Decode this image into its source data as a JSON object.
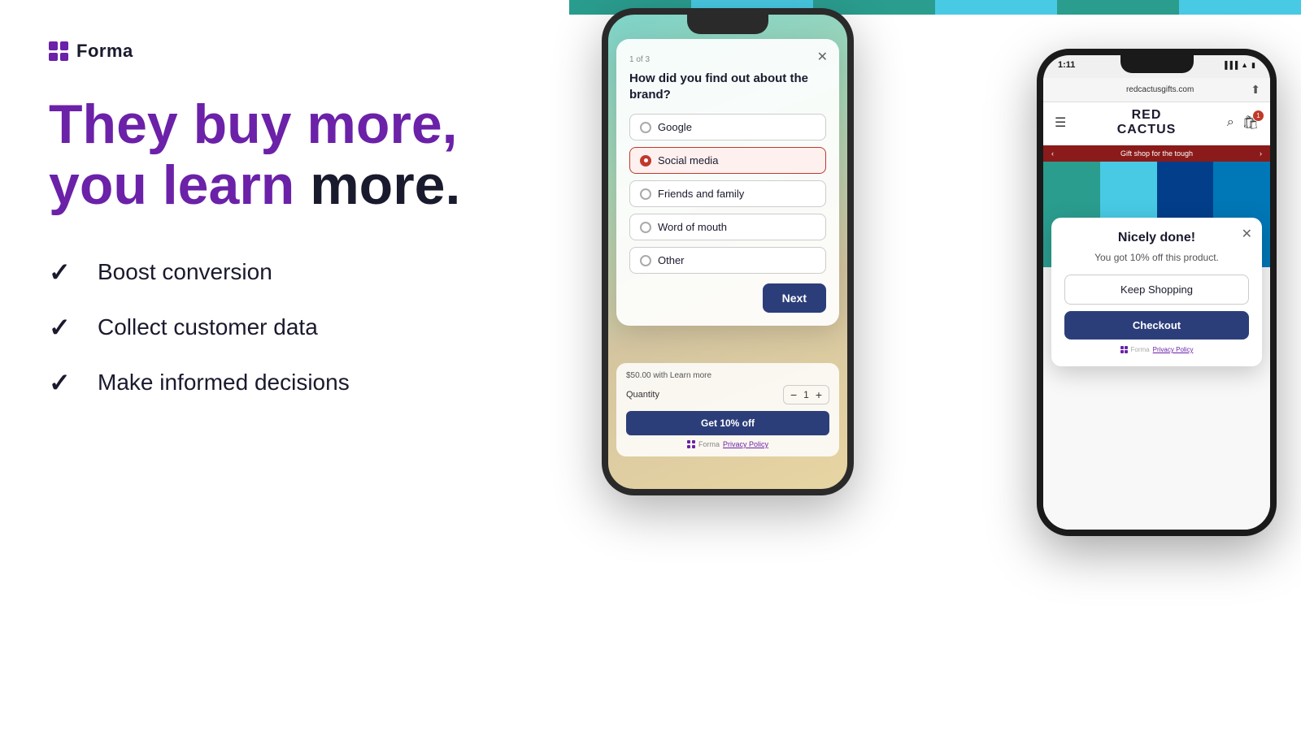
{
  "brand": {
    "name": "Forma",
    "logo_label": "Forma"
  },
  "hero": {
    "line1_purple": "They buy more,",
    "line2_purple": "you learn",
    "line2_dark": "more."
  },
  "features": [
    {
      "id": "boost",
      "label": "Boost conversion"
    },
    {
      "id": "collect",
      "label": "Collect customer data"
    },
    {
      "id": "decisions",
      "label": "Make informed decisions"
    }
  ],
  "survey_phone": {
    "progress": "1 of 3",
    "question": "How did you find out about the brand?",
    "options": [
      {
        "id": "google",
        "label": "Google",
        "selected": false
      },
      {
        "id": "social",
        "label": "Social media",
        "selected": true
      },
      {
        "id": "friends",
        "label": "Friends and family",
        "selected": false
      },
      {
        "id": "wom",
        "label": "Word of mouth",
        "selected": false
      },
      {
        "id": "other",
        "label": "Other",
        "selected": false
      }
    ],
    "next_label": "Next",
    "price_text": "$50.00 with  Learn more",
    "quantity_label": "Quantity",
    "qty_value": "1",
    "discount_btn": "Get 10% off",
    "powered_by": "Forma",
    "privacy_label": "Privacy Policy"
  },
  "redcactus_phone": {
    "time": "1:11",
    "url": "redcactusgifts.com",
    "brand_name_line1": "RED",
    "brand_name_line2": "CACTUS",
    "promo_text": "Gift shop for the tough",
    "success_title": "Nicely done!",
    "success_subtitle": "You got 10% off this product.",
    "keep_shopping_label": "Keep Shopping",
    "checkout_label": "Checkout",
    "powered_by": "Forma",
    "privacy_label": "Privacy Policy"
  },
  "colors": {
    "purple": "#6b21a8",
    "dark_navy": "#2c3e7a",
    "red_accent": "#c0392b",
    "teal": "#2a9d8f"
  }
}
